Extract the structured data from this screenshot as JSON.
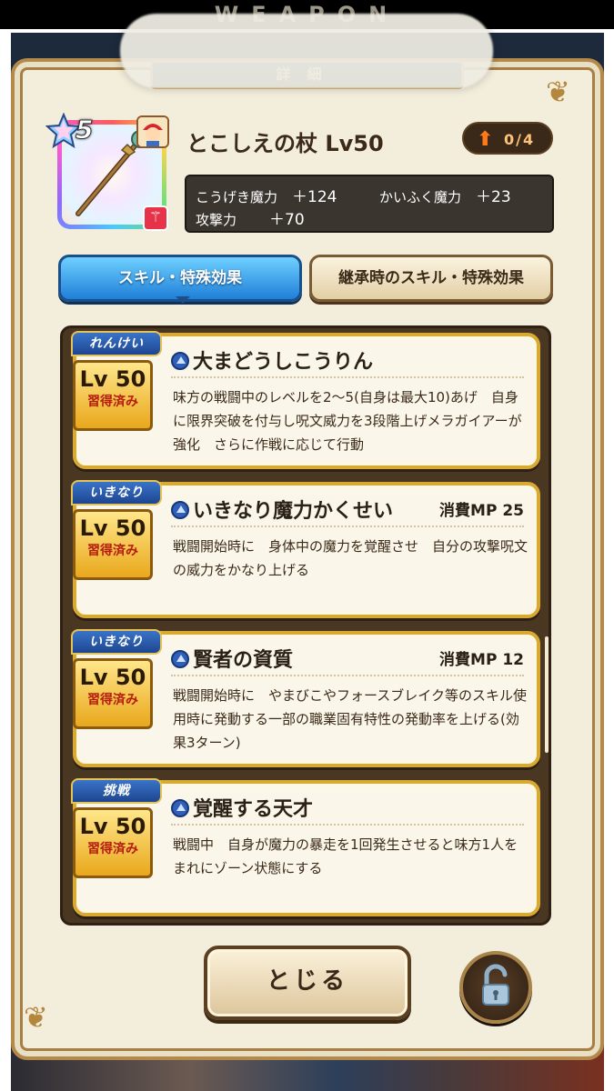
{
  "header": {
    "top_text": "WEAPON",
    "detail_title": "詳細"
  },
  "weapon": {
    "rarity": "5",
    "name": "とこしえの杖 Lv50",
    "upgrade": "0/4",
    "stats": [
      {
        "label": "こうげき魔力",
        "value": "＋124"
      },
      {
        "label": "かいふく魔力",
        "value": "＋23"
      },
      {
        "label": "攻撃力",
        "value": "＋70"
      }
    ]
  },
  "tabs": [
    {
      "label": "スキル・特殊効果",
      "active": true
    },
    {
      "label": "継承時のスキル・特殊効果",
      "active": false
    }
  ],
  "skills": [
    {
      "tag": "れんけい",
      "lv": "Lv 50",
      "learned": "習得済み",
      "title": "大まどうしこうりん",
      "mp": "",
      "desc": "味方の戦闘中のレベルを2〜5(自身は最大10)あげ　自身に限界突破を付与し呪文威力を3段階上げメラガイアーが強化　さらに作戦に応じて行動"
    },
    {
      "tag": "いきなり",
      "lv": "Lv 50",
      "learned": "習得済み",
      "title": "いきなり魔力かくせい",
      "mp": "消費MP 25",
      "desc": "戦闘開始時に　身体中の魔力を覚醒させ　自分の攻撃呪文の威力をかなり上げる"
    },
    {
      "tag": "いきなり",
      "lv": "Lv 50",
      "learned": "習得済み",
      "title": "賢者の資質",
      "mp": "消費MP 12",
      "desc": "戦闘開始時に　やまびこやフォースブレイク等のスキル使用時に発動する一部の職業固有特性の発動率を上げる(効果3ターン)"
    },
    {
      "tag": "挑戦",
      "lv": "Lv 50",
      "learned": "習得済み",
      "title": "覚醒する天才",
      "mp": "",
      "desc": "戦闘中　自身が魔力の暴走を1回発生させると味方1人をまれにゾーン状態にする"
    }
  ],
  "buttons": {
    "close": "とじる",
    "lock_icon": "unlock-icon"
  },
  "colors": {
    "panel": "#f3eddc",
    "frame_gold": "#b48a4c",
    "tab_active": "#1f7fd8",
    "card_border": "#d8aa34"
  }
}
